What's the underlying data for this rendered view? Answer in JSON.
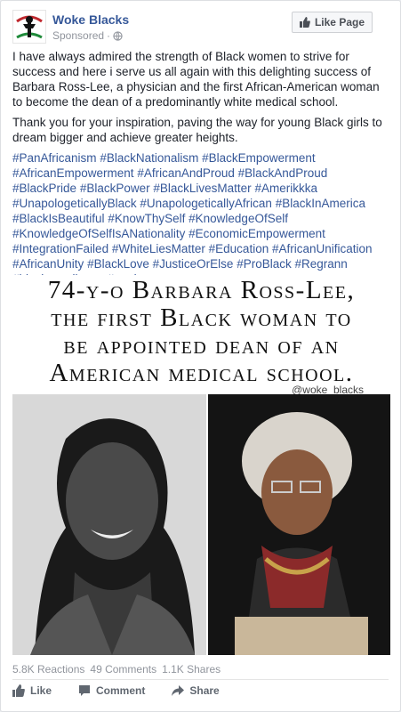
{
  "post": {
    "page_name": "Woke Blacks",
    "sponsored_label": "Sponsored",
    "separator": " · ",
    "like_page_label": "Like Page",
    "paragraphs": [
      "I have always admired the strength of Black women to strive for success and here i serve us all again with this delighting success of Barbara Ross-Lee, a physician and the first African-American woman to become the dean of a predominantly white medical school.",
      "Thank you for your inspiration, paving the way for young Black girls to dream bigger and achieve greater heights."
    ],
    "hashtags": [
      "#PanAfricanism",
      "#BlackNationalism",
      "#BlackEmpowerment",
      "#AfricanEmpowerment",
      "#AfricanAndProud",
      "#BlackAndProud",
      "#BlackPride",
      "#BlackPower",
      "#BlackLivesMatter",
      "#Amerikkka",
      "#UnapologeticallyBlack",
      "#UnapologeticallyAfrican",
      "#BlackInAmerica",
      "#BlackIsBeautiful",
      "#KnowThySelf",
      "#KnowledgeOfSelf",
      "#KnowledgeOfSelfIsANationality",
      "#EconomicEmpowerment",
      "#IntegrationFailed",
      "#WhiteLiesMatter",
      "#Education",
      "#AfricanUnification",
      "#AfricanUnity",
      "#BlackLove",
      "#JusticeOrElse",
      "#ProBlack",
      "#Regrann",
      "#blackexcellence",
      "#goals"
    ]
  },
  "image": {
    "headline_lines": [
      "74-y-o Barbara Ross-Lee,",
      "the first Black woman to",
      "be appointed dean of an",
      "American medical school."
    ],
    "watermark": "@woke_blacks"
  },
  "stats": {
    "reactions": "5.8K Reactions",
    "comments": "49 Comments",
    "shares": "1.1K Shares"
  },
  "actions": {
    "like_label": "Like",
    "comment_label": "Comment",
    "share_label": "Share"
  },
  "colors": {
    "link_blue": "#365899",
    "text": "#1d2129",
    "meta_gray": "#90949c"
  },
  "icons": {
    "avatar": "woke-blacks-logo",
    "globe": "globe-icon",
    "like_page": "thumbs-up-icon",
    "like": "thumbs-up-icon",
    "comment": "comment-bubble-icon",
    "share": "share-arrow-icon"
  }
}
